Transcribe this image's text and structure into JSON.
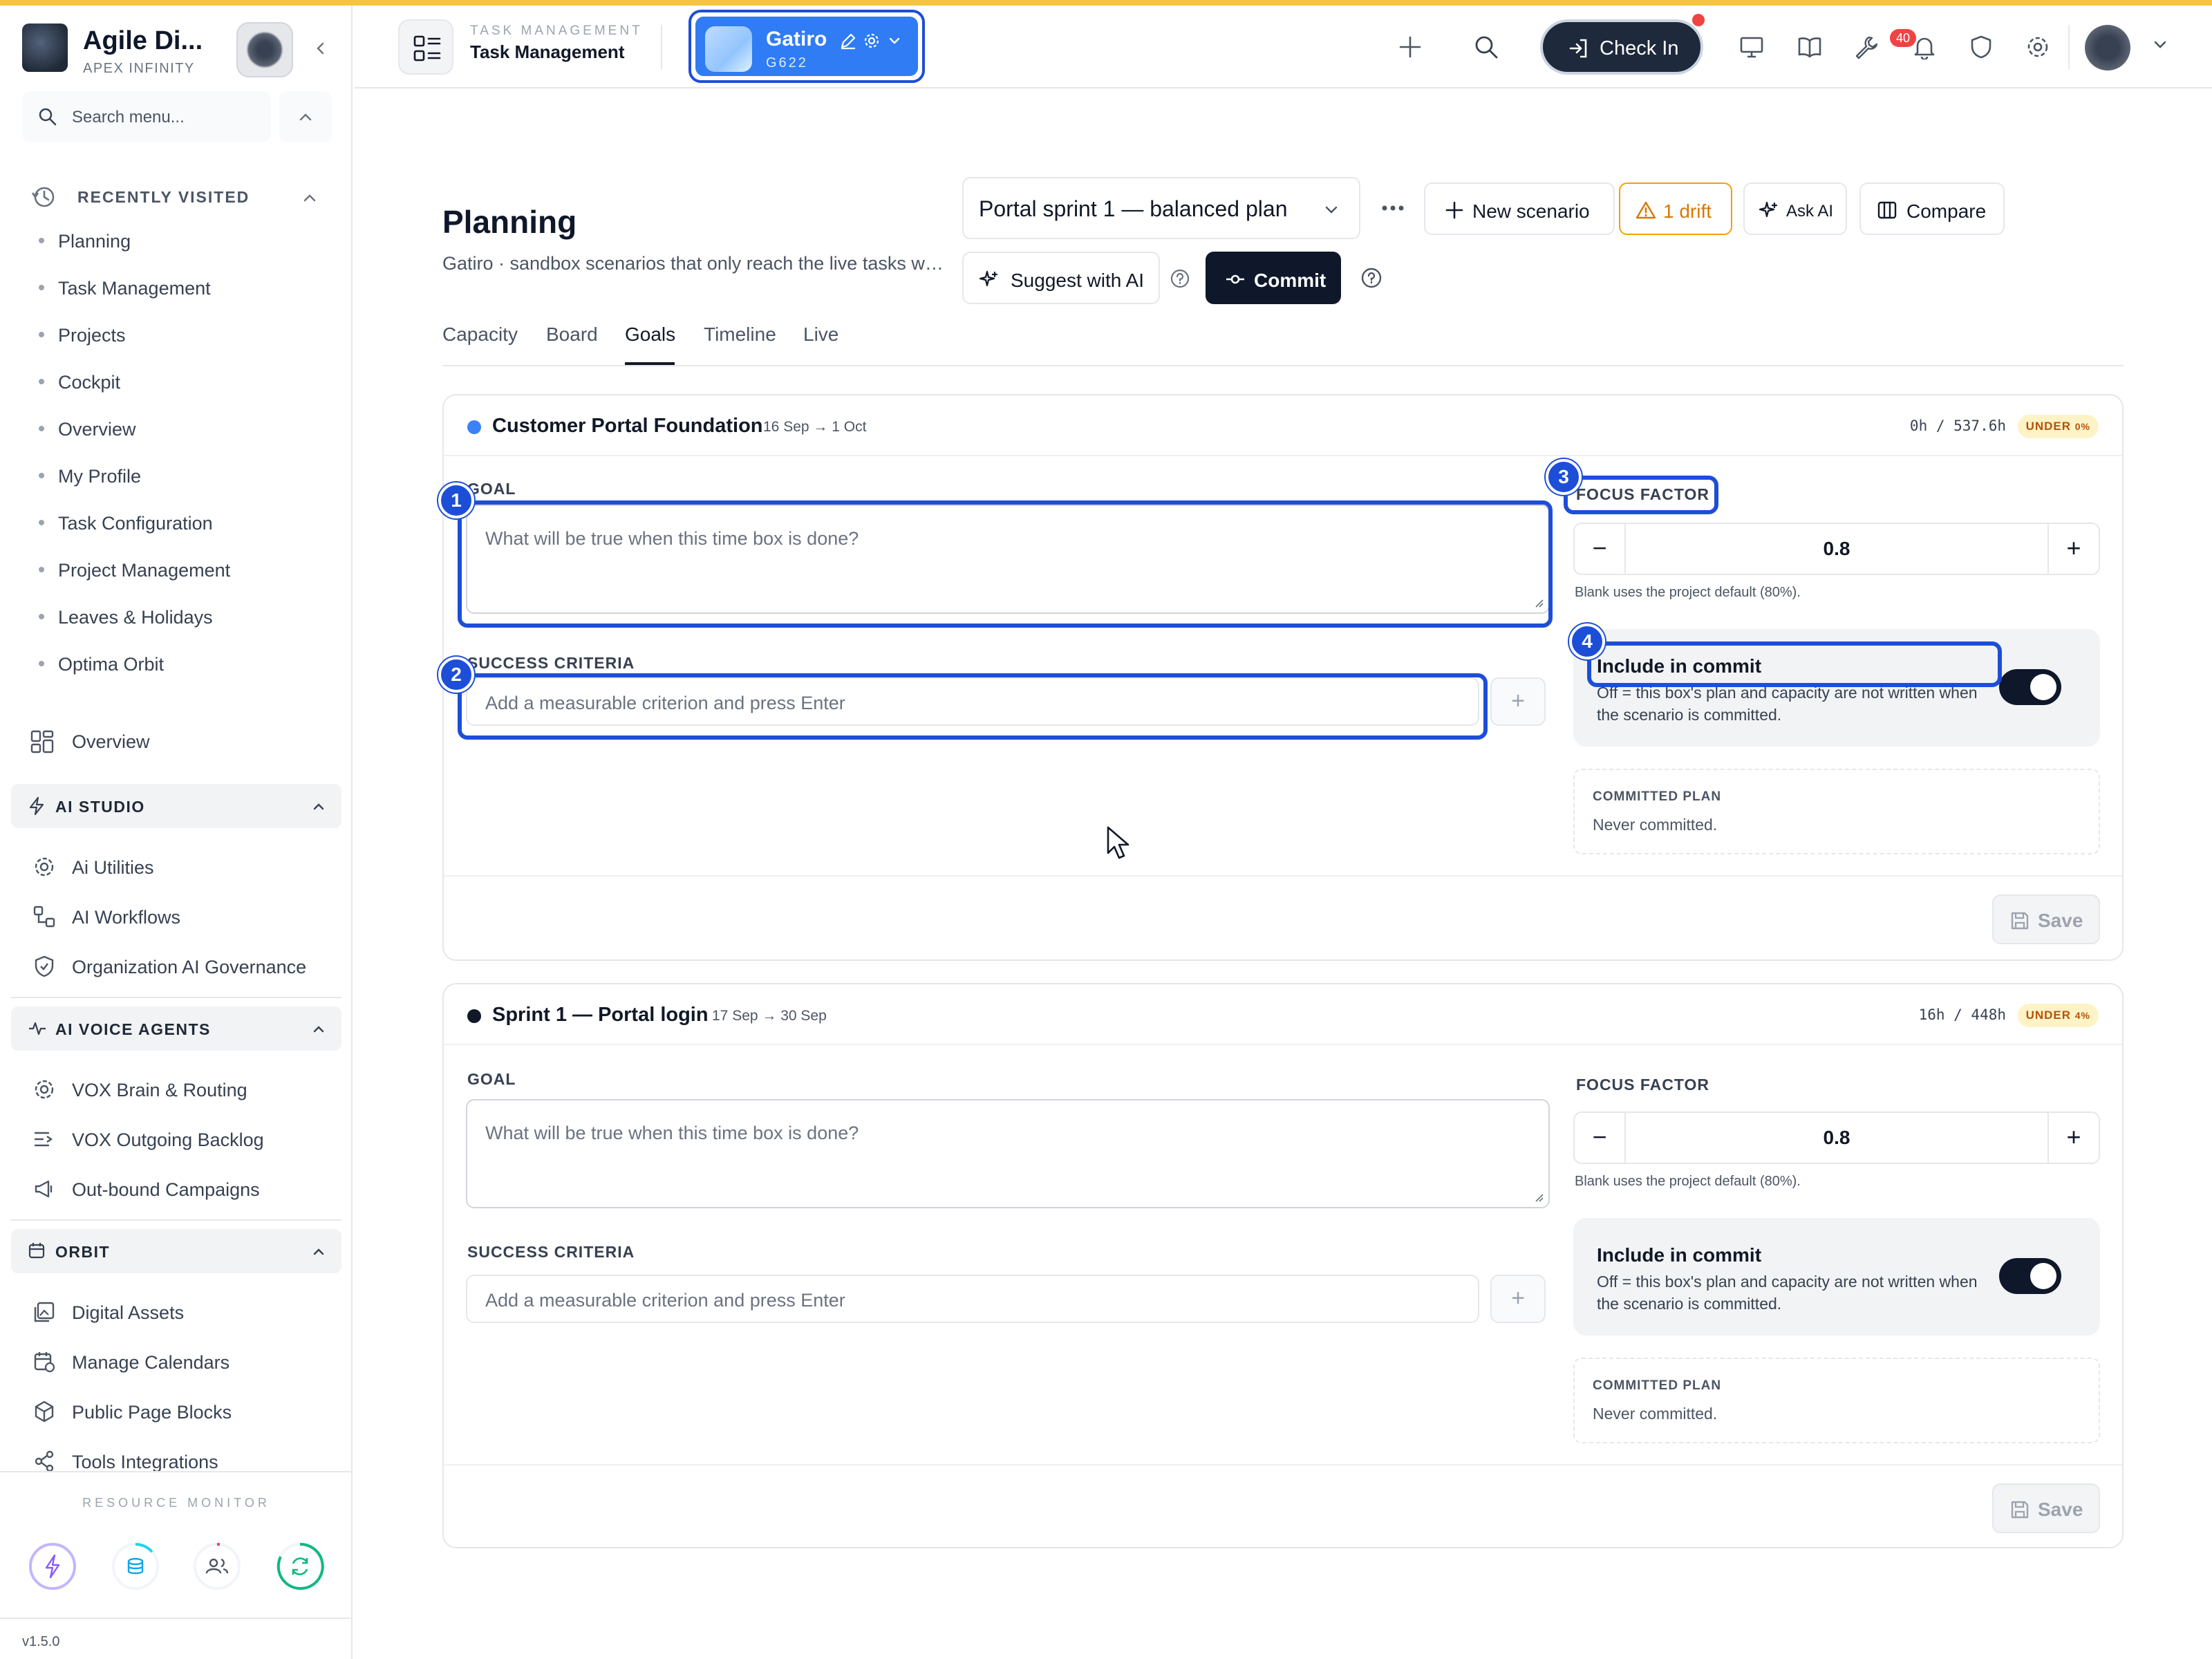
{
  "sidebar": {
    "brand_name": "Agile Di...",
    "brand_sub": "APEX INFINITY",
    "search_placeholder": "Search menu...",
    "recently_visited_label": "RECENTLY VISITED",
    "recent": [
      "Planning",
      "Task Management",
      "Projects",
      "Cockpit",
      "Overview",
      "My Profile",
      "Task Configuration",
      "Project Management",
      "Leaves & Holidays",
      "Optima Orbit"
    ],
    "overview_label": "Overview",
    "ai_studio": {
      "label": "AI STUDIO",
      "items": [
        "Ai Utilities",
        "AI Workflows",
        "Organization AI Governance"
      ]
    },
    "ai_voice": {
      "label": "AI VOICE AGENTS",
      "items": [
        "VOX Brain & Routing",
        "VOX Outgoing Backlog",
        "Out-bound Campaigns"
      ]
    },
    "orbit": {
      "label": "ORBIT",
      "items": [
        "Digital Assets",
        "Manage Calendars",
        "Public Page Blocks",
        "Tools Integrations"
      ]
    },
    "resource_monitor_label": "RESOURCE MONITOR",
    "version": "v1.5.0"
  },
  "header": {
    "module_eyebrow": "TASK MANAGEMENT",
    "module_title": "Task Management",
    "project_name": "Gatiro",
    "project_code": "G622",
    "checkin_label": "Check In",
    "notification_count": "40"
  },
  "page": {
    "title": "Planning",
    "subtitle": "Gatiro · sandbox scenarios that only reach the live tasks when committed",
    "scenario": "Portal sprint 1 — balanced plan",
    "buttons": {
      "new_scenario": "New scenario",
      "drift": "1 drift",
      "ask_ai": "Ask AI",
      "compare": "Compare",
      "suggest": "Suggest with AI",
      "commit": "Commit"
    },
    "tabs": [
      "Capacity",
      "Board",
      "Goals",
      "Timeline",
      "Live"
    ],
    "active_tab": "Goals"
  },
  "labels": {
    "goal": "GOAL",
    "goal_placeholder": "What will be true when this time box is done?",
    "success_criteria": "SUCCESS CRITERIA",
    "criteria_placeholder": "Add a measurable criterion and press Enter",
    "focus_factor": "FOCUS FACTOR",
    "focus_hint": "Blank uses the project default (80%).",
    "include_title": "Include in commit",
    "include_desc": "Off = this box's plan and capacity are not written when the scenario is committed.",
    "committed_plan": "COMMITTED PLAN",
    "never_committed": "Never committed.",
    "save": "Save"
  },
  "timeboxes": [
    {
      "name": "Customer Portal Foundation",
      "dates": "16 Sep → 1 Oct",
      "hours": "0h / 537.6h",
      "badge": "UNDER",
      "badge_pct": "0%",
      "focus": "0.8",
      "dot_color": "#3b82f6"
    },
    {
      "name": "Sprint 1 — Portal login",
      "dates": "17 Sep → 30 Sep",
      "hours": "16h / 448h",
      "badge": "UNDER",
      "badge_pct": "4%",
      "focus": "0.8",
      "dot_color": "#111827"
    }
  ],
  "highlights": [
    "1",
    "2",
    "3",
    "4"
  ],
  "colors": {
    "accent": "#1d4ed8",
    "chip": "#2f7cf4",
    "warning": "#f59e0b",
    "dark": "#0f172a"
  }
}
